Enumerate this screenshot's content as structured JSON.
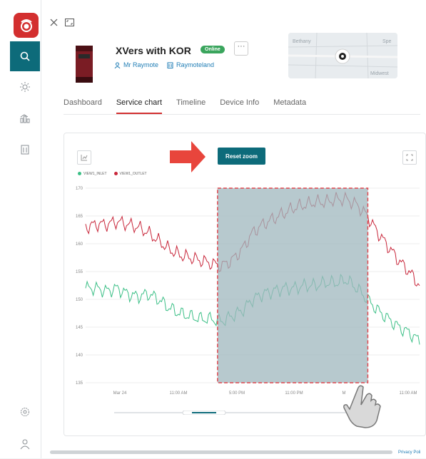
{
  "device": {
    "title": "XVers with KOR",
    "status": "Online",
    "more_label": "···",
    "owner": "Mr Raymote",
    "location": "Raymoteland"
  },
  "map": {
    "labels": [
      "Bethany",
      "Spe",
      "Midwest"
    ]
  },
  "tabs": [
    {
      "label": "Dashboard",
      "active": false
    },
    {
      "label": "Service chart",
      "active": true
    },
    {
      "label": "Timeline",
      "active": false
    },
    {
      "label": "Device Info",
      "active": false
    },
    {
      "label": "Metadata",
      "active": false
    }
  ],
  "toolbar": {
    "reset_zoom_label": "Reset zoom"
  },
  "footer": {
    "privacy_label": "Privacy Poli"
  },
  "colors": {
    "accent": "#0d6b7a",
    "brand_red": "#d32f2f",
    "inlet": "#3bbf86",
    "outlet": "#c8263a",
    "selection": "#9fb7bd"
  },
  "icons": {
    "sidebar": [
      "search-icon",
      "sun-icon",
      "bar-chart-icon",
      "building-icon",
      "settings-icon",
      "user-icon"
    ],
    "top": [
      "close-icon",
      "expand-icon"
    ]
  },
  "chart_data": {
    "type": "line",
    "x_labels": [
      "Mar 24",
      "11:00 AM",
      "5:00 PM",
      "11:00 PM",
      "M",
      "11:00 AM"
    ],
    "y_ticks": [
      135,
      140,
      145,
      150,
      155,
      160,
      165,
      170
    ],
    "ylim": [
      135,
      170
    ],
    "series": [
      {
        "name": "VIEW1_INLET",
        "color": "#3bbf86",
        "values": [
          152,
          152,
          151.5,
          152,
          151,
          150.5,
          151,
          150,
          148.5,
          147.5,
          147,
          146.5,
          146.5,
          146,
          147,
          148,
          150,
          151,
          151.5,
          152,
          152,
          152.5,
          152.5,
          153,
          153,
          153.5,
          152,
          150,
          148,
          146.5,
          145,
          144,
          142.5
        ]
      },
      {
        "name": "VIEW1_OUTLET",
        "color": "#c8263a",
        "values": [
          163,
          163.5,
          163.5,
          164,
          163.5,
          163,
          162,
          160.5,
          159,
          158,
          157.5,
          157,
          156.5,
          156,
          157,
          159,
          162,
          163.5,
          164.5,
          165.5,
          166.5,
          167,
          167.5,
          167.5,
          168,
          168,
          167,
          165,
          162,
          159.5,
          157,
          155,
          152.5
        ]
      }
    ],
    "selection_range": [
      0.395,
      0.845
    ]
  }
}
